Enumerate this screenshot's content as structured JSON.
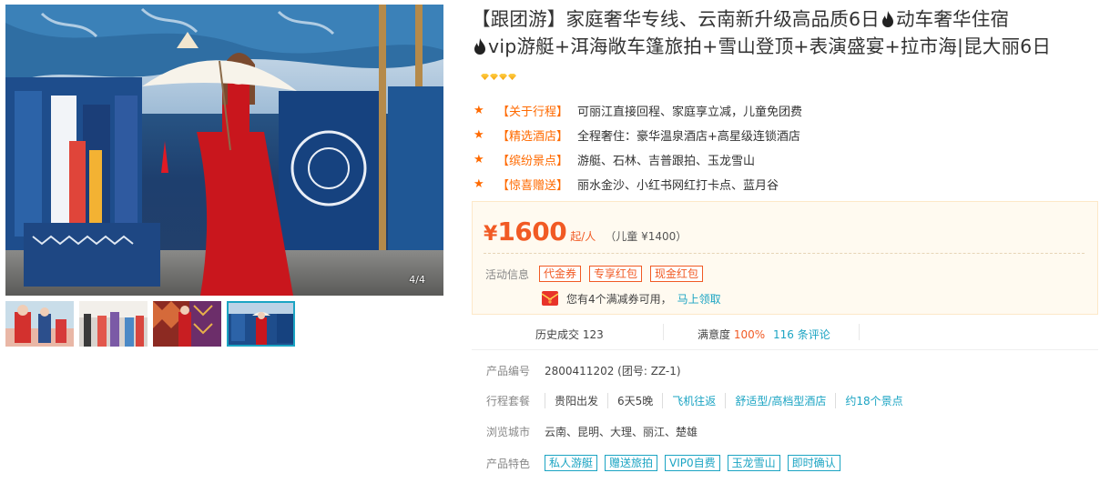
{
  "gallery": {
    "counter": "4/4",
    "thumbnails": [
      "thumb-1",
      "thumb-2",
      "thumb-3",
      "thumb-4"
    ],
    "active_index": 3
  },
  "title": {
    "part1": "【跟团游】家庭奢华专线、云南新升级高品质6日",
    "part2": "动车奢华住宿",
    "part3": "vip游艇+洱海敞车篷旅拍+雪山登顶+表演盛宴+拉市海|昆大丽6日",
    "flame_icon": "flame-icon",
    "diamond_count": 4
  },
  "features": [
    {
      "tag": "【关于行程】",
      "text": "可丽江直接回程、家庭享立减，儿童免团费"
    },
    {
      "tag": "【精选酒店】",
      "text": "全程奢住：豪华温泉酒店+高星级连锁酒店"
    },
    {
      "tag": "【缤纷景点】",
      "text": "游艇、石林、吉普跟拍、玉龙雪山"
    },
    {
      "tag": "【惊喜赠送】",
      "text": "丽水金沙、小红书网红打卡点、蓝月谷"
    }
  ],
  "price": {
    "currency": "¥",
    "value": "1600",
    "unit": "起/人",
    "child": "（儿童 ¥1400）"
  },
  "promo": {
    "label": "活动信息",
    "coupons": [
      "代金券",
      "专享红包",
      "现金红包"
    ],
    "voucher_text": "您有4个满减券可用，",
    "voucher_link": "马上领取"
  },
  "stats": {
    "sales": "历史成交 123",
    "satisfaction_label": "满意度",
    "satisfaction_value": "100%",
    "reviews": "116 条评论"
  },
  "details": {
    "product_no_label": "产品编号",
    "product_no_value": "2800411202 (团号: ZZ-1)",
    "plan_label": "行程套餐",
    "plan_items": [
      "贵阳出发",
      "6天5晚",
      "飞机往返",
      "舒适型/高档型酒店",
      "约18个景点"
    ],
    "cities_label": "浏览城市",
    "cities_value": "云南、昆明、大理、丽江、楚雄",
    "features_label": "产品特色",
    "feature_chips": [
      "私人游艇",
      "赠送旅拍",
      "VIP0自费",
      "玉龙雪山",
      "即时确认"
    ]
  },
  "colors": {
    "accent_orange": "#f15a24",
    "link_teal": "#1ba4c3",
    "price_bg": "#fffaf0"
  }
}
